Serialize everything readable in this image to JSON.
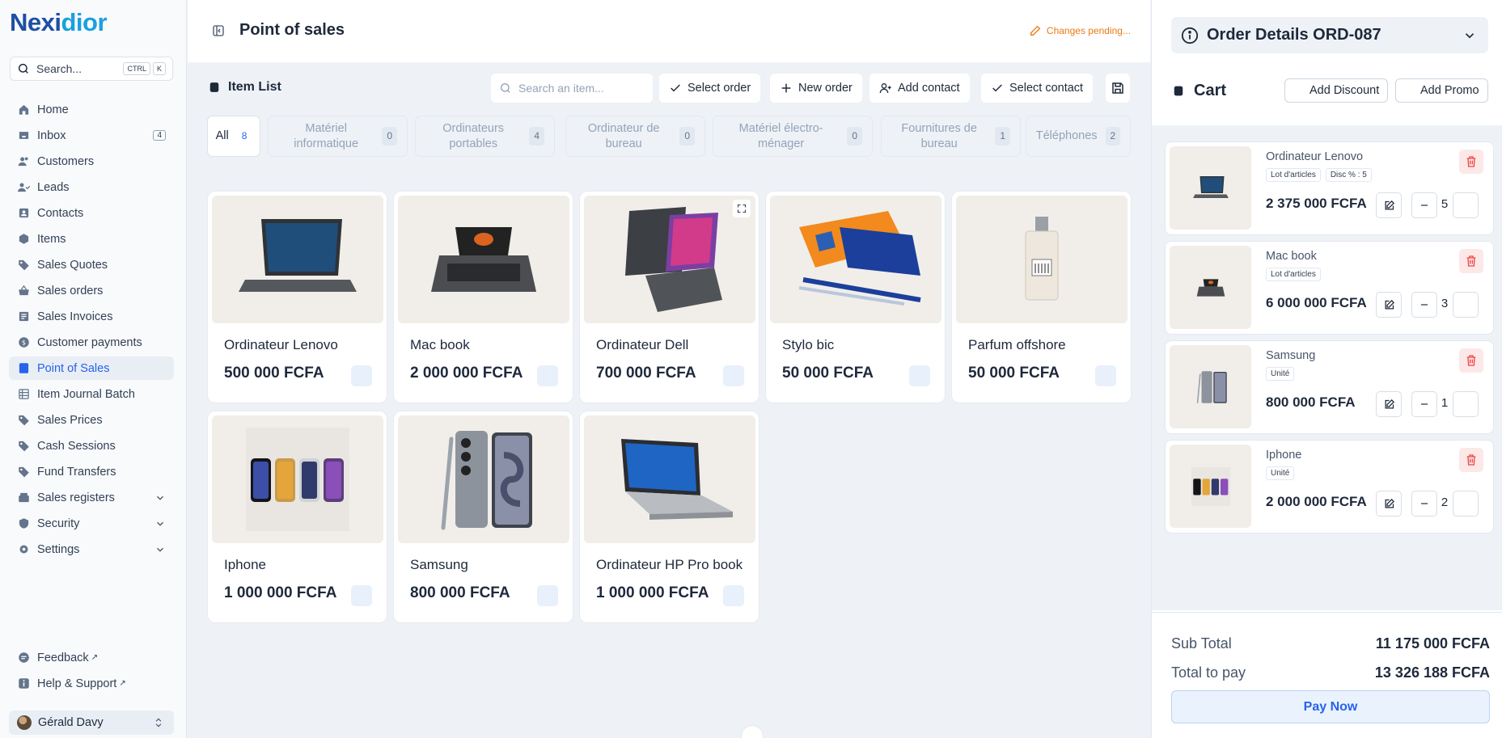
{
  "brand": {
    "name_a": "Nexi",
    "name_b": "dior"
  },
  "search": {
    "label": "Search...",
    "kbd1": "CTRL",
    "kbd2": "K"
  },
  "nav": {
    "items": [
      {
        "label": "Home",
        "icon": "home-icon"
      },
      {
        "label": "Inbox",
        "icon": "inbox-icon",
        "badge": "4"
      },
      {
        "label": "Customers",
        "icon": "users-icon"
      },
      {
        "label": "Leads",
        "icon": "leads-icon"
      },
      {
        "label": "Contacts",
        "icon": "contacts-icon"
      },
      {
        "label": "Items",
        "icon": "box-icon"
      },
      {
        "label": "Sales Quotes",
        "icon": "tag-icon"
      },
      {
        "label": "Sales orders",
        "icon": "basket-icon"
      },
      {
        "label": "Sales Invoices",
        "icon": "invoice-icon"
      },
      {
        "label": "Customer payments",
        "icon": "dollar-icon"
      },
      {
        "label": "Point of Sales",
        "icon": "pos-icon",
        "active": true
      },
      {
        "label": "Item Journal Batch",
        "icon": "grid-icon"
      },
      {
        "label": "Sales Prices",
        "icon": "tag-icon"
      },
      {
        "label": "Cash Sessions",
        "icon": "tag-icon"
      },
      {
        "label": "Fund Transfers",
        "icon": "tag-icon"
      },
      {
        "label": "Sales registers",
        "icon": "register-icon",
        "expandable": true
      },
      {
        "label": "Security",
        "icon": "shield-icon",
        "expandable": true
      },
      {
        "label": "Settings",
        "icon": "gear-icon",
        "expandable": true
      }
    ],
    "feedback": "Feedback",
    "help": "Help & Support"
  },
  "user": {
    "name": "Gérald Davy"
  },
  "header": {
    "title": "Point of sales",
    "status": "Changes pending..."
  },
  "toolbar": {
    "list_title": "Item List",
    "search_placeholder": "Search an item...",
    "select_order": "Select order",
    "new_order": "New order",
    "add_contact": "Add contact",
    "select_contact": "Select contact"
  },
  "categories": [
    {
      "label": "All",
      "count": "8",
      "active": true
    },
    {
      "label": "Matériel informatique",
      "count": "0"
    },
    {
      "label": "Ordinateurs portables",
      "count": "4"
    },
    {
      "label": "Ordinateur de bureau",
      "count": "0"
    },
    {
      "label": "Matériel électro-ménager",
      "count": "0"
    },
    {
      "label": "Fournitures de bureau",
      "count": "1"
    },
    {
      "label": "Téléphones",
      "count": "2"
    }
  ],
  "products": [
    {
      "name": "Ordinateur Lenovo",
      "price": "500 000 FCFA",
      "image": "laptop-lenovo"
    },
    {
      "name": "Mac book",
      "price": "2 000 000 FCFA",
      "image": "laptop-mac"
    },
    {
      "name": "Ordinateur Dell",
      "price": "700 000 FCFA",
      "image": "laptop-dell"
    },
    {
      "name": "Stylo bic",
      "price": "50 000 FCFA",
      "image": "pens"
    },
    {
      "name": "Parfum offshore",
      "price": "50 000 FCFA",
      "image": "perfume"
    },
    {
      "name": "Iphone",
      "price": "1 000 000 FCFA",
      "image": "iphones"
    },
    {
      "name": "Samsung",
      "price": "800 000 FCFA",
      "image": "samsung"
    },
    {
      "name": "Ordinateur HP Pro book",
      "price": "1 000 000 FCFA",
      "image": "laptop-hp"
    }
  ],
  "order": {
    "title": "Order Details ORD-087",
    "cart_title": "Cart",
    "add_discount": "Add Discount",
    "add_promo": "Add Promo",
    "items": [
      {
        "name": "Ordinateur Lenovo",
        "tags": [
          "Lot d'articles",
          "Disc % : 5"
        ],
        "price": "2 375 000 FCFA",
        "qty": "5",
        "image": "laptop-lenovo"
      },
      {
        "name": "Mac book",
        "tags": [
          "Lot d'articles"
        ],
        "price": "6 000 000 FCFA",
        "qty": "3",
        "image": "laptop-mac"
      },
      {
        "name": "Samsung",
        "tags": [
          "Unité"
        ],
        "price": "800 000 FCFA",
        "qty": "1",
        "image": "samsung"
      },
      {
        "name": "Iphone",
        "tags": [
          "Unité"
        ],
        "price": "2 000 000 FCFA",
        "qty": "2",
        "image": "iphones"
      }
    ],
    "subtotal_label": "Sub Total",
    "subtotal": "11 175 000 FCFA",
    "total_label": "Total to pay",
    "total": "13 326 188 FCFA",
    "pay_now": "Pay Now"
  },
  "colors": {
    "primary": "#2563eb",
    "brand_dark": "#1e4fa3",
    "brand_light": "#1ba0de",
    "pending": "#ea7a12",
    "danger": "#ef4444"
  }
}
